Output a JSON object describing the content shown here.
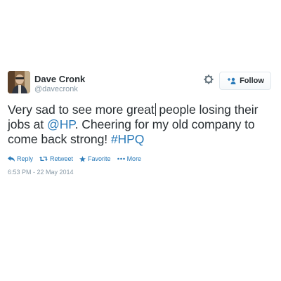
{
  "user": {
    "display_name": "Dave Cronk",
    "screen_name": "@davecronk",
    "avatar_icon": "user-avatar-photo"
  },
  "header": {
    "settings_icon": "gear-icon",
    "follow_label": "Follow",
    "follow_icon": "add-user-icon"
  },
  "tweet": {
    "text_part1": "Very sad to see more great",
    "text_part2": " people losing their jobs at ",
    "mention": "@HP",
    "text_part3": ". Cheering for my old company to come back strong! ",
    "hashtag": "#HPQ"
  },
  "actions": {
    "reply_label": "Reply",
    "retweet_label": "Retweet",
    "favorite_label": "Favorite",
    "more_label": "More"
  },
  "meta": {
    "timestamp": "6:53 PM - 22 May 2014"
  },
  "colors": {
    "link": "#2b7bb9",
    "text": "#292f33",
    "muted": "#8899a6",
    "border": "#e1e8ed"
  }
}
